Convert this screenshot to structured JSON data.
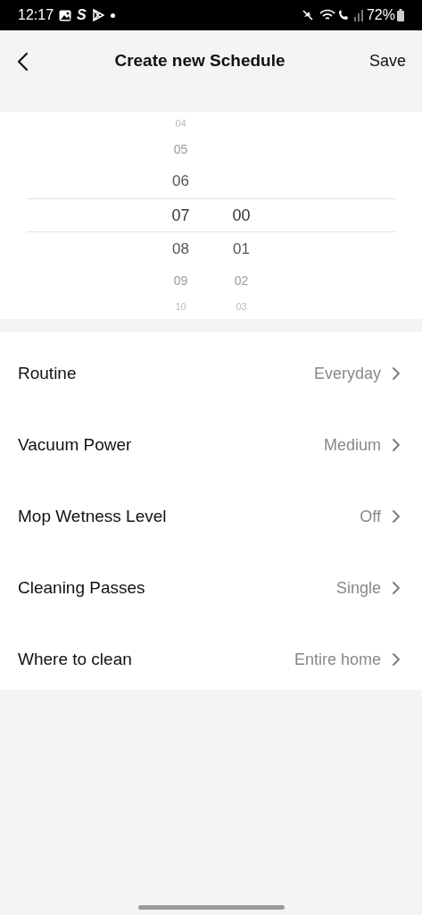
{
  "status_bar": {
    "time": "12:17",
    "app_letter": "S",
    "battery": "72%"
  },
  "header": {
    "title": "Create new Schedule",
    "action": "Save"
  },
  "time_picker": {
    "hours": [
      {
        "label": "04",
        "selected": false
      },
      {
        "label": "05",
        "selected": false
      },
      {
        "label": "06",
        "selected": false
      },
      {
        "label": "07",
        "selected": true
      },
      {
        "label": "08",
        "selected": false
      },
      {
        "label": "09",
        "selected": false
      },
      {
        "label": "10",
        "selected": false
      }
    ],
    "minutes": [
      {
        "label": "00",
        "selected": true
      },
      {
        "label": "01",
        "selected": false
      },
      {
        "label": "02",
        "selected": false
      },
      {
        "label": "03",
        "selected": false
      }
    ]
  },
  "settings": [
    {
      "label": "Routine",
      "value": "Everyday"
    },
    {
      "label": "Vacuum Power",
      "value": "Medium"
    },
    {
      "label": "Mop Wetness Level",
      "value": "Off"
    },
    {
      "label": "Cleaning Passes",
      "value": "Single"
    },
    {
      "label": "Where to clean",
      "value": "Entire home"
    }
  ]
}
